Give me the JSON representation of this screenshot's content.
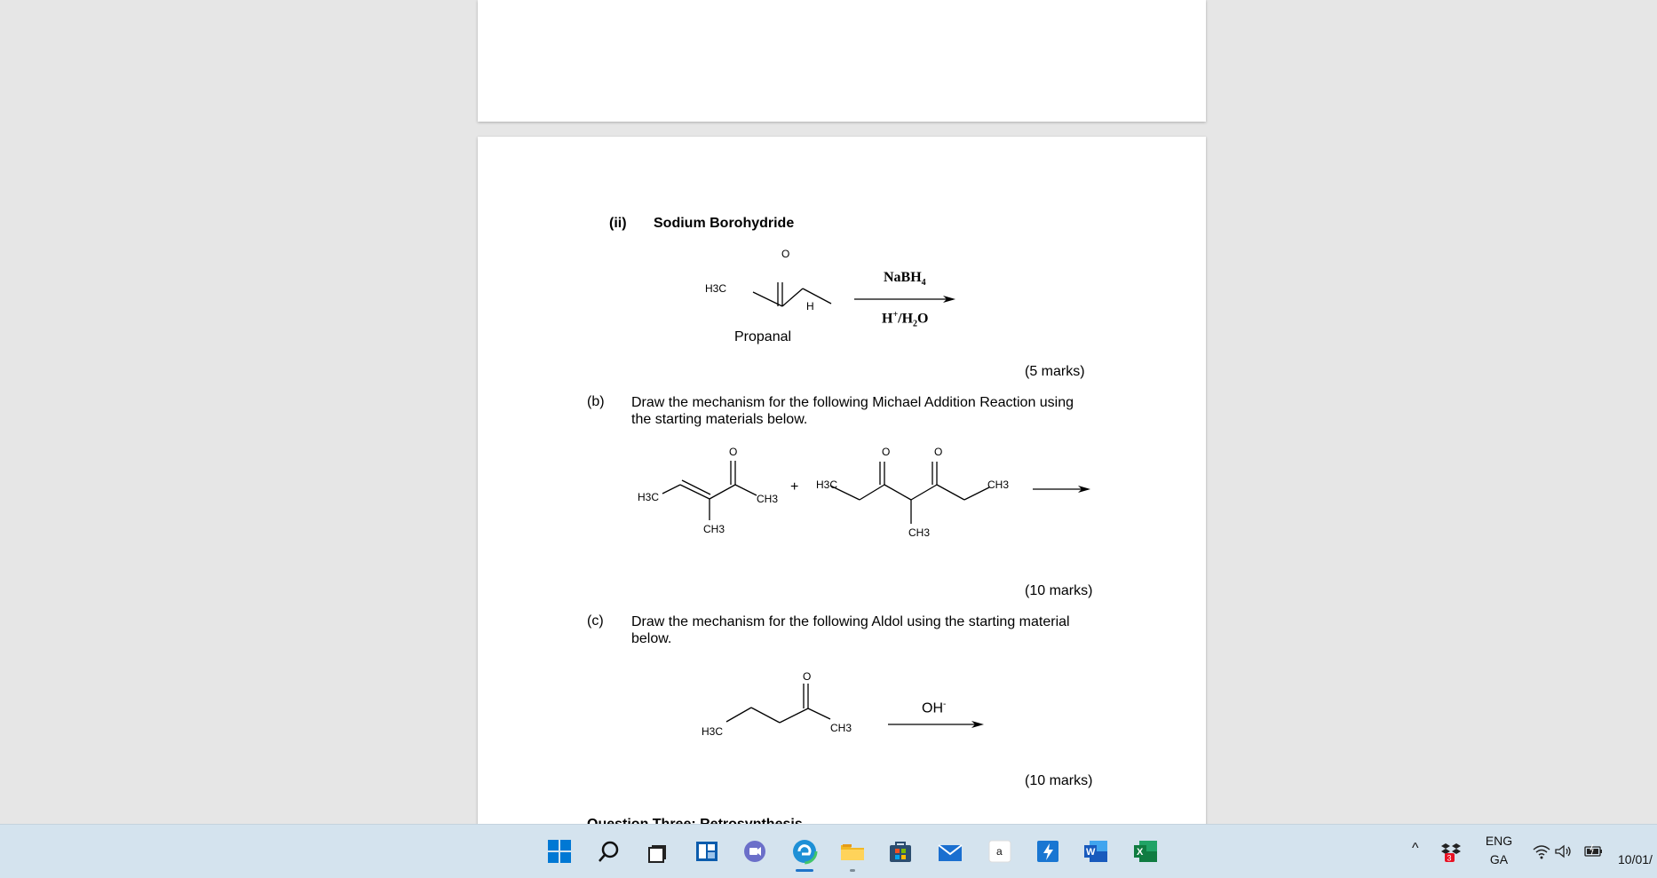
{
  "document": {
    "part_ii": {
      "number": "(ii)",
      "title": "Sodium Borohydride",
      "reagent_top": "NaBH",
      "reagent_top_sub": "4",
      "reagent_bottom_h": "H",
      "reagent_bottom_sup": "+",
      "reagent_bottom_rest": "/H",
      "reagent_bottom_sub": "2",
      "reagent_bottom_o": "O",
      "compound_name": "Propanal",
      "marks": "(5 marks)",
      "labels": {
        "o": "O",
        "h3c": "H3C",
        "h": "H"
      }
    },
    "part_b": {
      "letter": "(b)",
      "text": "Draw the mechanism for the following Michael Addition Reaction using the starting materials below.",
      "plus": "+",
      "marks": "(10 marks)",
      "labels": {
        "o": "O",
        "h3c": "H3C",
        "ch3": "CH3"
      }
    },
    "part_c": {
      "letter": "(c)",
      "text": "Draw the mechanism for the following Aldol using the starting material below.",
      "reagent": "OH",
      "reagent_sup": "-",
      "marks": "(10 marks)",
      "labels": {
        "o": "O",
        "h3c": "H3C",
        "ch3": "CH3"
      }
    },
    "next_heading_cut": "Question Three: Retrosynthesis"
  },
  "taskbar": {
    "apps": [
      "start-icon",
      "search-icon",
      "task-view-icon",
      "widgets-icon",
      "teams-chat-icon",
      "edge-icon",
      "file-explorer-icon",
      "microsoft-store-icon",
      "mail-icon",
      "amazon-icon",
      "power-automate-icon",
      "word-icon",
      "excel-icon"
    ],
    "tray": {
      "chevron": "^",
      "badge_count": "3",
      "lang_top": "ENG",
      "lang_bottom": "GA",
      "date": "10/01/"
    }
  },
  "colors": {
    "background": "#e6e6e6",
    "taskbar": "#d4e3ee",
    "page": "#ffffff",
    "windows_blue": "#0078d4",
    "word_blue": "#185abd",
    "excel_green": "#107c41"
  }
}
